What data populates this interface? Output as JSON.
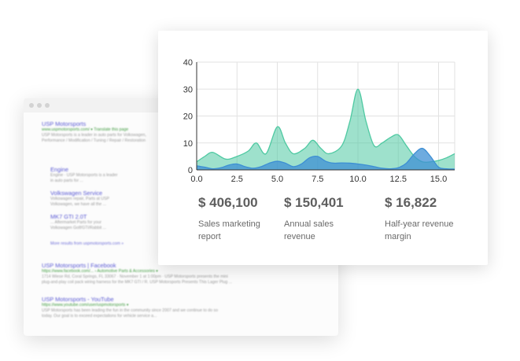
{
  "search_results": [
    {
      "title": "USP Motorsports",
      "url": "www.uspmotorsports.com/ ▾ Translate this page",
      "snippet": [
        "USP Motorsports is a leader in auto parts for Volkswagen,",
        "Performance / Modification / Tuning / Repair / Restoration"
      ],
      "indent": false
    },
    {
      "title": "Engine",
      "url": "",
      "snippet": [
        "Engine · USP Motorsports is a leader",
        "in auto parts for ..."
      ],
      "indent": true
    },
    {
      "title": "Volkswagen Service",
      "url": "",
      "snippet": [
        "Volkswagen repair, Parts at USP",
        "Volkswagen, we have all the ..."
      ],
      "indent": true
    },
    {
      "title": "MK7 GTI 2.0T",
      "url": "",
      "snippet": [
        "... Aftermarket Parts for your",
        "Volkswagen Golf/GTI/Rabbit ..."
      ],
      "indent": true
    },
    {
      "title": "",
      "url": "",
      "more": "More results from uspmotorsports.com »",
      "snippet": [],
      "indent": true
    },
    {
      "title": "USP Motorsports | Facebook",
      "url": "https://www.facebook.com/... › Automotive Parts & Accessories ▾",
      "snippet": [
        "1714 Wiese Rd, Coral Springs, FL 33067 · November 1 at 1:00pm · USP Motorsports presents the mini",
        "plug-and-play coil pack wiring harness for the MK7 GTI / R. USP Motorsports Presents This Lager Plug ..."
      ],
      "indent": false
    },
    {
      "title": "USP Motorsports - YouTube",
      "url": "https://www.youtube.com/user/uspmotorsports ▾",
      "snippet": [
        "USP Motorsports has been leading the fun in the community since 2007 and we continue to do so",
        "today. Our goal is to exceed expectations for vehicle service a..."
      ],
      "indent": false
    }
  ],
  "chart_data": {
    "type": "area",
    "x_ticks": [
      "0.0",
      "2.5",
      "5.0",
      "7.5",
      "10.0",
      "12.5",
      "15.0"
    ],
    "y_ticks": [
      "0",
      "10",
      "20",
      "30",
      "40"
    ],
    "xlim": [
      0,
      16
    ],
    "ylim": [
      0,
      40
    ],
    "grid": true,
    "series": [
      {
        "color": "#4fc9a2",
        "x": [
          0,
          0.5,
          1,
          1.8,
          2.5,
          3.2,
          3.7,
          4.3,
          5,
          5.5,
          6,
          6.7,
          7.2,
          7.7,
          8.2,
          9,
          9.5,
          10,
          10.5,
          11,
          11.5,
          12,
          12.5,
          13,
          13.5,
          14,
          14.5,
          15,
          15.5,
          16
        ],
        "values": [
          3,
          5,
          6.5,
          4,
          5,
          7,
          10,
          6,
          16,
          10,
          6,
          8,
          11,
          8,
          6,
          9,
          18,
          30,
          18,
          9,
          10,
          12,
          13,
          9,
          5,
          3,
          3,
          3.5,
          4.5,
          6
        ]
      },
      {
        "color": "#3d8fd4",
        "x": [
          0,
          0.5,
          1,
          1.5,
          2,
          2.5,
          3,
          3.5,
          4,
          4.5,
          5,
          5.5,
          6,
          6.5,
          7,
          7.5,
          8,
          8.5,
          9,
          9.5,
          10,
          10.5,
          11,
          11.5,
          12,
          12.5,
          13,
          13.5,
          14,
          14.5,
          15,
          15.5,
          16
        ],
        "values": [
          1.5,
          1,
          0.4,
          0.8,
          1.8,
          2.2,
          1.2,
          0.6,
          1.2,
          2.5,
          3.2,
          2.5,
          1.2,
          2.2,
          4.5,
          5,
          3.2,
          2.5,
          2.6,
          2.5,
          2.2,
          1.8,
          1.2,
          0.6,
          0.4,
          0.8,
          2.5,
          6,
          8,
          5,
          1,
          0.4,
          0.3
        ]
      }
    ]
  },
  "stats": [
    {
      "value": "$ 406,100",
      "label": "Sales marketing report"
    },
    {
      "value": "$ 150,401",
      "label": "Annual sales revenue"
    },
    {
      "value": "$ 16,822",
      "label": "Half-year revenue margin"
    }
  ]
}
